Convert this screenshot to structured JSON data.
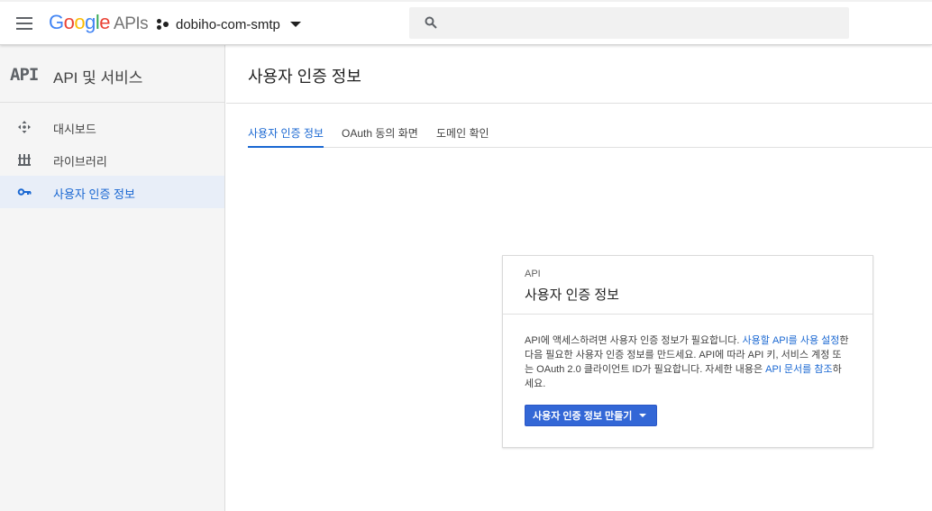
{
  "topbar": {
    "logo": {
      "google": "Google",
      "apis": "APIs"
    },
    "project": "dobiho-com-smtp",
    "search": {
      "placeholder": "",
      "value": ""
    }
  },
  "sidebar": {
    "mark": "API",
    "title": "API 및 서비스",
    "items": [
      {
        "label": "대시보드",
        "icon": "dashboard-icon"
      },
      {
        "label": "라이브러리",
        "icon": "library-icon"
      },
      {
        "label": "사용자 인증 정보",
        "icon": "key-icon",
        "active": true
      }
    ]
  },
  "page": {
    "title": "사용자 인증 정보",
    "tabs": [
      {
        "label": "사용자 인증 정보",
        "active": true
      },
      {
        "label": "OAuth 동의 화면"
      },
      {
        "label": "도메인 확인"
      }
    ]
  },
  "card": {
    "eyebrow": "API",
    "title": "사용자 인증 정보",
    "body": {
      "text1": "API에 액세스하려면 사용자 인증 정보가 필요합니다. ",
      "link1": "사용할 API를 사용 설정",
      "text2": "한 다음 필요한 사용자 인증 정보를 만드세요. API에 따라 API 키, 서비스 계정 또는 OAuth 2.0 클라이언트 ID가 필요합니다. 자세한 내용은 ",
      "link2": "API 문서를 참조",
      "text3": "하세요."
    },
    "button": "사용자 인증 정보 만들기"
  },
  "colors": {
    "accent": "#1967d2",
    "button": "#3367d6"
  }
}
